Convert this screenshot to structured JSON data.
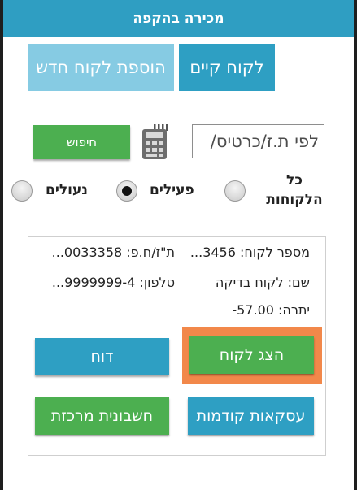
{
  "header": {
    "title": "מכירה בהקפה"
  },
  "tabs": {
    "existing": "לקוח קיים",
    "new": "הוספת לקוח חדש"
  },
  "search": {
    "placeholder": "לפי ת.ז/כרטיס/",
    "button": "חיפוש",
    "icon": "calculator-icon"
  },
  "filters": {
    "all": "כל הלקוחות",
    "active": "פעילים",
    "locked": "נעולים",
    "selected": "active"
  },
  "customer": {
    "number": "מספר לקוח: 3456...",
    "id": "ת\"ז/ח.פ: 0033358...",
    "name": "שם: לקוח בדיקה",
    "phone": "טלפון: 9999999-4...",
    "balance": "יתרה: 57.00-"
  },
  "actions": {
    "show_customer": "הצג לקוח",
    "report": "דוח",
    "previous_deals": "עסקאות קודמות",
    "central_invoice": "חשבונית מרכזת"
  },
  "colors": {
    "header": "#2f9ec2",
    "blue": "#2e9fc3",
    "green": "#4caf50",
    "highlight": "#f2884a"
  }
}
